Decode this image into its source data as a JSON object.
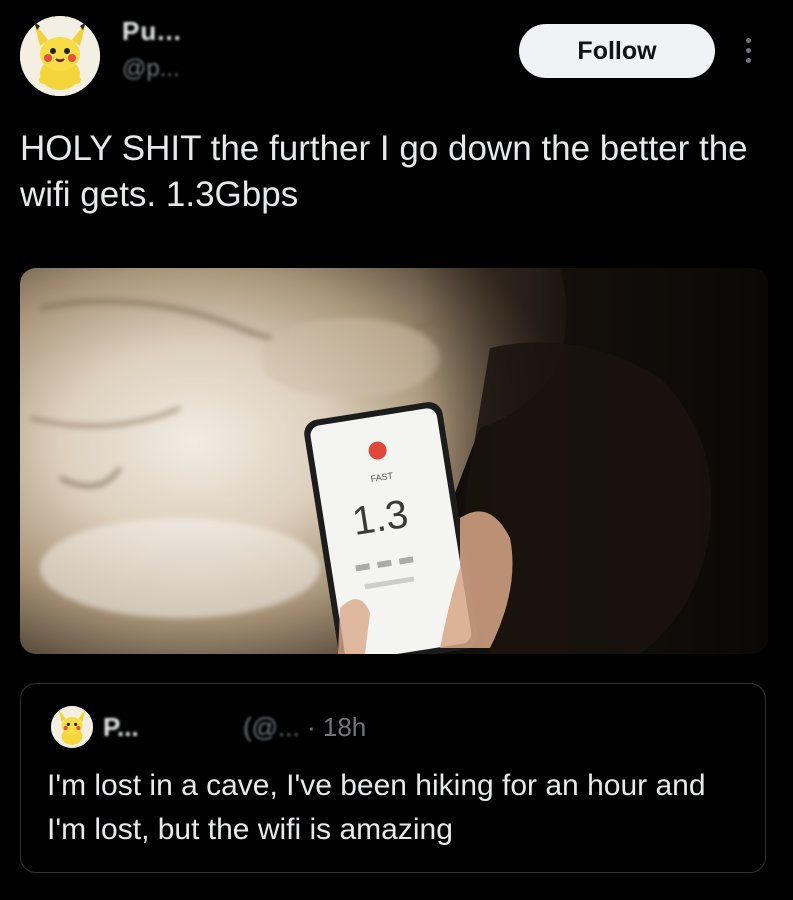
{
  "colors": {
    "background": "#000000",
    "text_primary": "#e7e9ea",
    "text_secondary": "#71767b",
    "follow_bg": "#eff3f4",
    "border": "#2f3336"
  },
  "author": {
    "display_name": "Pu...",
    "handle": "@p...",
    "avatar_icon": "pikachu-avatar-icon"
  },
  "actions": {
    "follow_label": "Follow",
    "more_icon": "more-dots-icon"
  },
  "tweet": {
    "text": "HOLY SHIT the further I go down the better the wifi gets. 1.3Gbps"
  },
  "media": {
    "description_icon": "cave-phone-photo",
    "phone_screen_brand": "FAST",
    "phone_screen_value": "1.3"
  },
  "quoted": {
    "display_name": "P...",
    "handle_blurred": "(@... ",
    "separator": "·",
    "time": "18h",
    "text": "I'm lost in a cave, I've been hiking for an hour and I'm lost, but the wifi is amazing"
  }
}
